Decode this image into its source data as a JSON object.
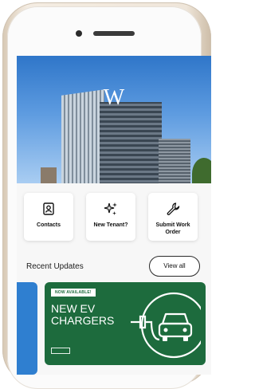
{
  "actions": [
    {
      "label": "Contacts",
      "icon": "contact-card-icon"
    },
    {
      "label": "New Tenant?",
      "icon": "sparkles-icon"
    },
    {
      "label": "Submit Work Order",
      "icon": "wrench-icon"
    }
  ],
  "hero": {
    "logo_text": "W"
  },
  "recent": {
    "title": "Recent Updates",
    "view_all_label": "View all"
  },
  "feature_card": {
    "badge": "NOW AVAILABLE!",
    "headline": "NEW EV CHARGERS",
    "icon": "ev-charger-car-icon",
    "accent_color": "#1d6b3d"
  },
  "colors": {
    "hero_sky": "#2f76c9",
    "side_card": "#2f7fd0",
    "phone_frame": "#efe6da"
  }
}
